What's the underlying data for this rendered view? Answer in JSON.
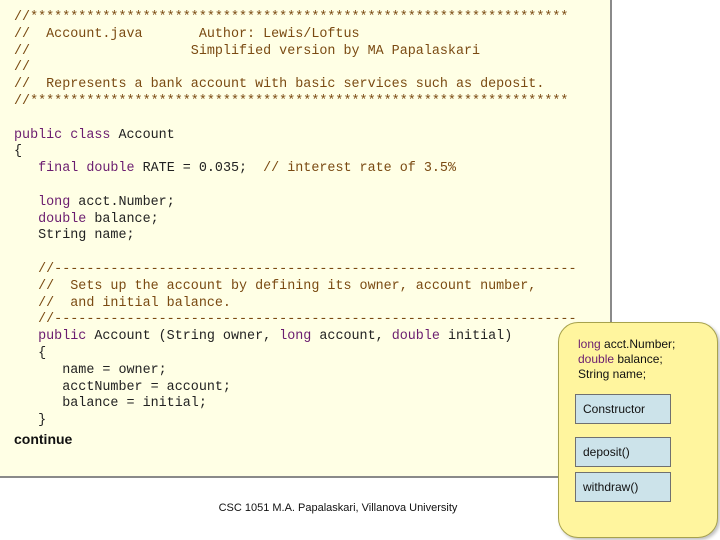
{
  "code": {
    "lines": [
      [
        {
          "t": "//*******************************************************************",
          "c": "cm"
        }
      ],
      [
        {
          "t": "//  Account.java       Author: Lewis/Loftus",
          "c": "cm"
        }
      ],
      [
        {
          "t": "//                    Simplified version by MA Papalaskari",
          "c": "cm"
        }
      ],
      [
        {
          "t": "//",
          "c": "cm"
        }
      ],
      [
        {
          "t": "//  Represents a bank account with basic services such as deposit.",
          "c": "cm"
        }
      ],
      [
        {
          "t": "//*******************************************************************",
          "c": "cm"
        }
      ],
      [],
      [
        {
          "t": "public class",
          "c": "kw"
        },
        {
          "t": " Account",
          "c": ""
        }
      ],
      [
        {
          "t": "{",
          "c": ""
        }
      ],
      [
        {
          "t": "   ",
          "c": ""
        },
        {
          "t": "final double",
          "c": "kw"
        },
        {
          "t": " RATE = 0.035;  ",
          "c": ""
        },
        {
          "t": "// interest rate of 3.5%",
          "c": "cm"
        }
      ],
      [],
      [
        {
          "t": "   ",
          "c": ""
        },
        {
          "t": "long",
          "c": "kw"
        },
        {
          "t": " acct.Number;",
          "c": ""
        }
      ],
      [
        {
          "t": "   ",
          "c": ""
        },
        {
          "t": "double",
          "c": "kw"
        },
        {
          "t": " balance;",
          "c": ""
        }
      ],
      [
        {
          "t": "   String name;",
          "c": ""
        }
      ],
      [],
      [
        {
          "t": "   //-----------------------------------------------------------------",
          "c": "cm"
        }
      ],
      [
        {
          "t": "   //  Sets up the account by defining its owner, account number,",
          "c": "cm"
        }
      ],
      [
        {
          "t": "   //  and initial balance.",
          "c": "cm"
        }
      ],
      [
        {
          "t": "   //-----------------------------------------------------------------",
          "c": "cm"
        }
      ],
      [
        {
          "t": "   ",
          "c": ""
        },
        {
          "t": "public",
          "c": "kw"
        },
        {
          "t": " Account (String owner, ",
          "c": ""
        },
        {
          "t": "long",
          "c": "kw"
        },
        {
          "t": " account, ",
          "c": ""
        },
        {
          "t": "double",
          "c": "kw"
        },
        {
          "t": " initial)",
          "c": ""
        }
      ],
      [
        {
          "t": "   {",
          "c": ""
        }
      ],
      [
        {
          "t": "      name = owner;",
          "c": ""
        }
      ],
      [
        {
          "t": "      acctNumber = account;",
          "c": ""
        }
      ],
      [
        {
          "t": "      balance = initial;",
          "c": ""
        }
      ],
      [
        {
          "t": "   }",
          "c": ""
        }
      ]
    ],
    "continue_label": "continue"
  },
  "card": {
    "fields": [
      {
        "kw": "long",
        "rest": " acct.Number;"
      },
      {
        "kw": "double",
        "rest": " balance;"
      },
      {
        "kw": "",
        "rest": "String name;"
      }
    ],
    "constructor_label": "Constructor",
    "methods": [
      "deposit()",
      "withdraw()"
    ]
  },
  "footer": "CSC 1051 M.A. Papalaskari, Villanova University",
  "colors": {
    "code_background": "#ffffe5",
    "comment": "#7a4a12",
    "keyword": "#6b1d6f",
    "card_background": "#fff59e",
    "method_box": "#cce3ea"
  }
}
